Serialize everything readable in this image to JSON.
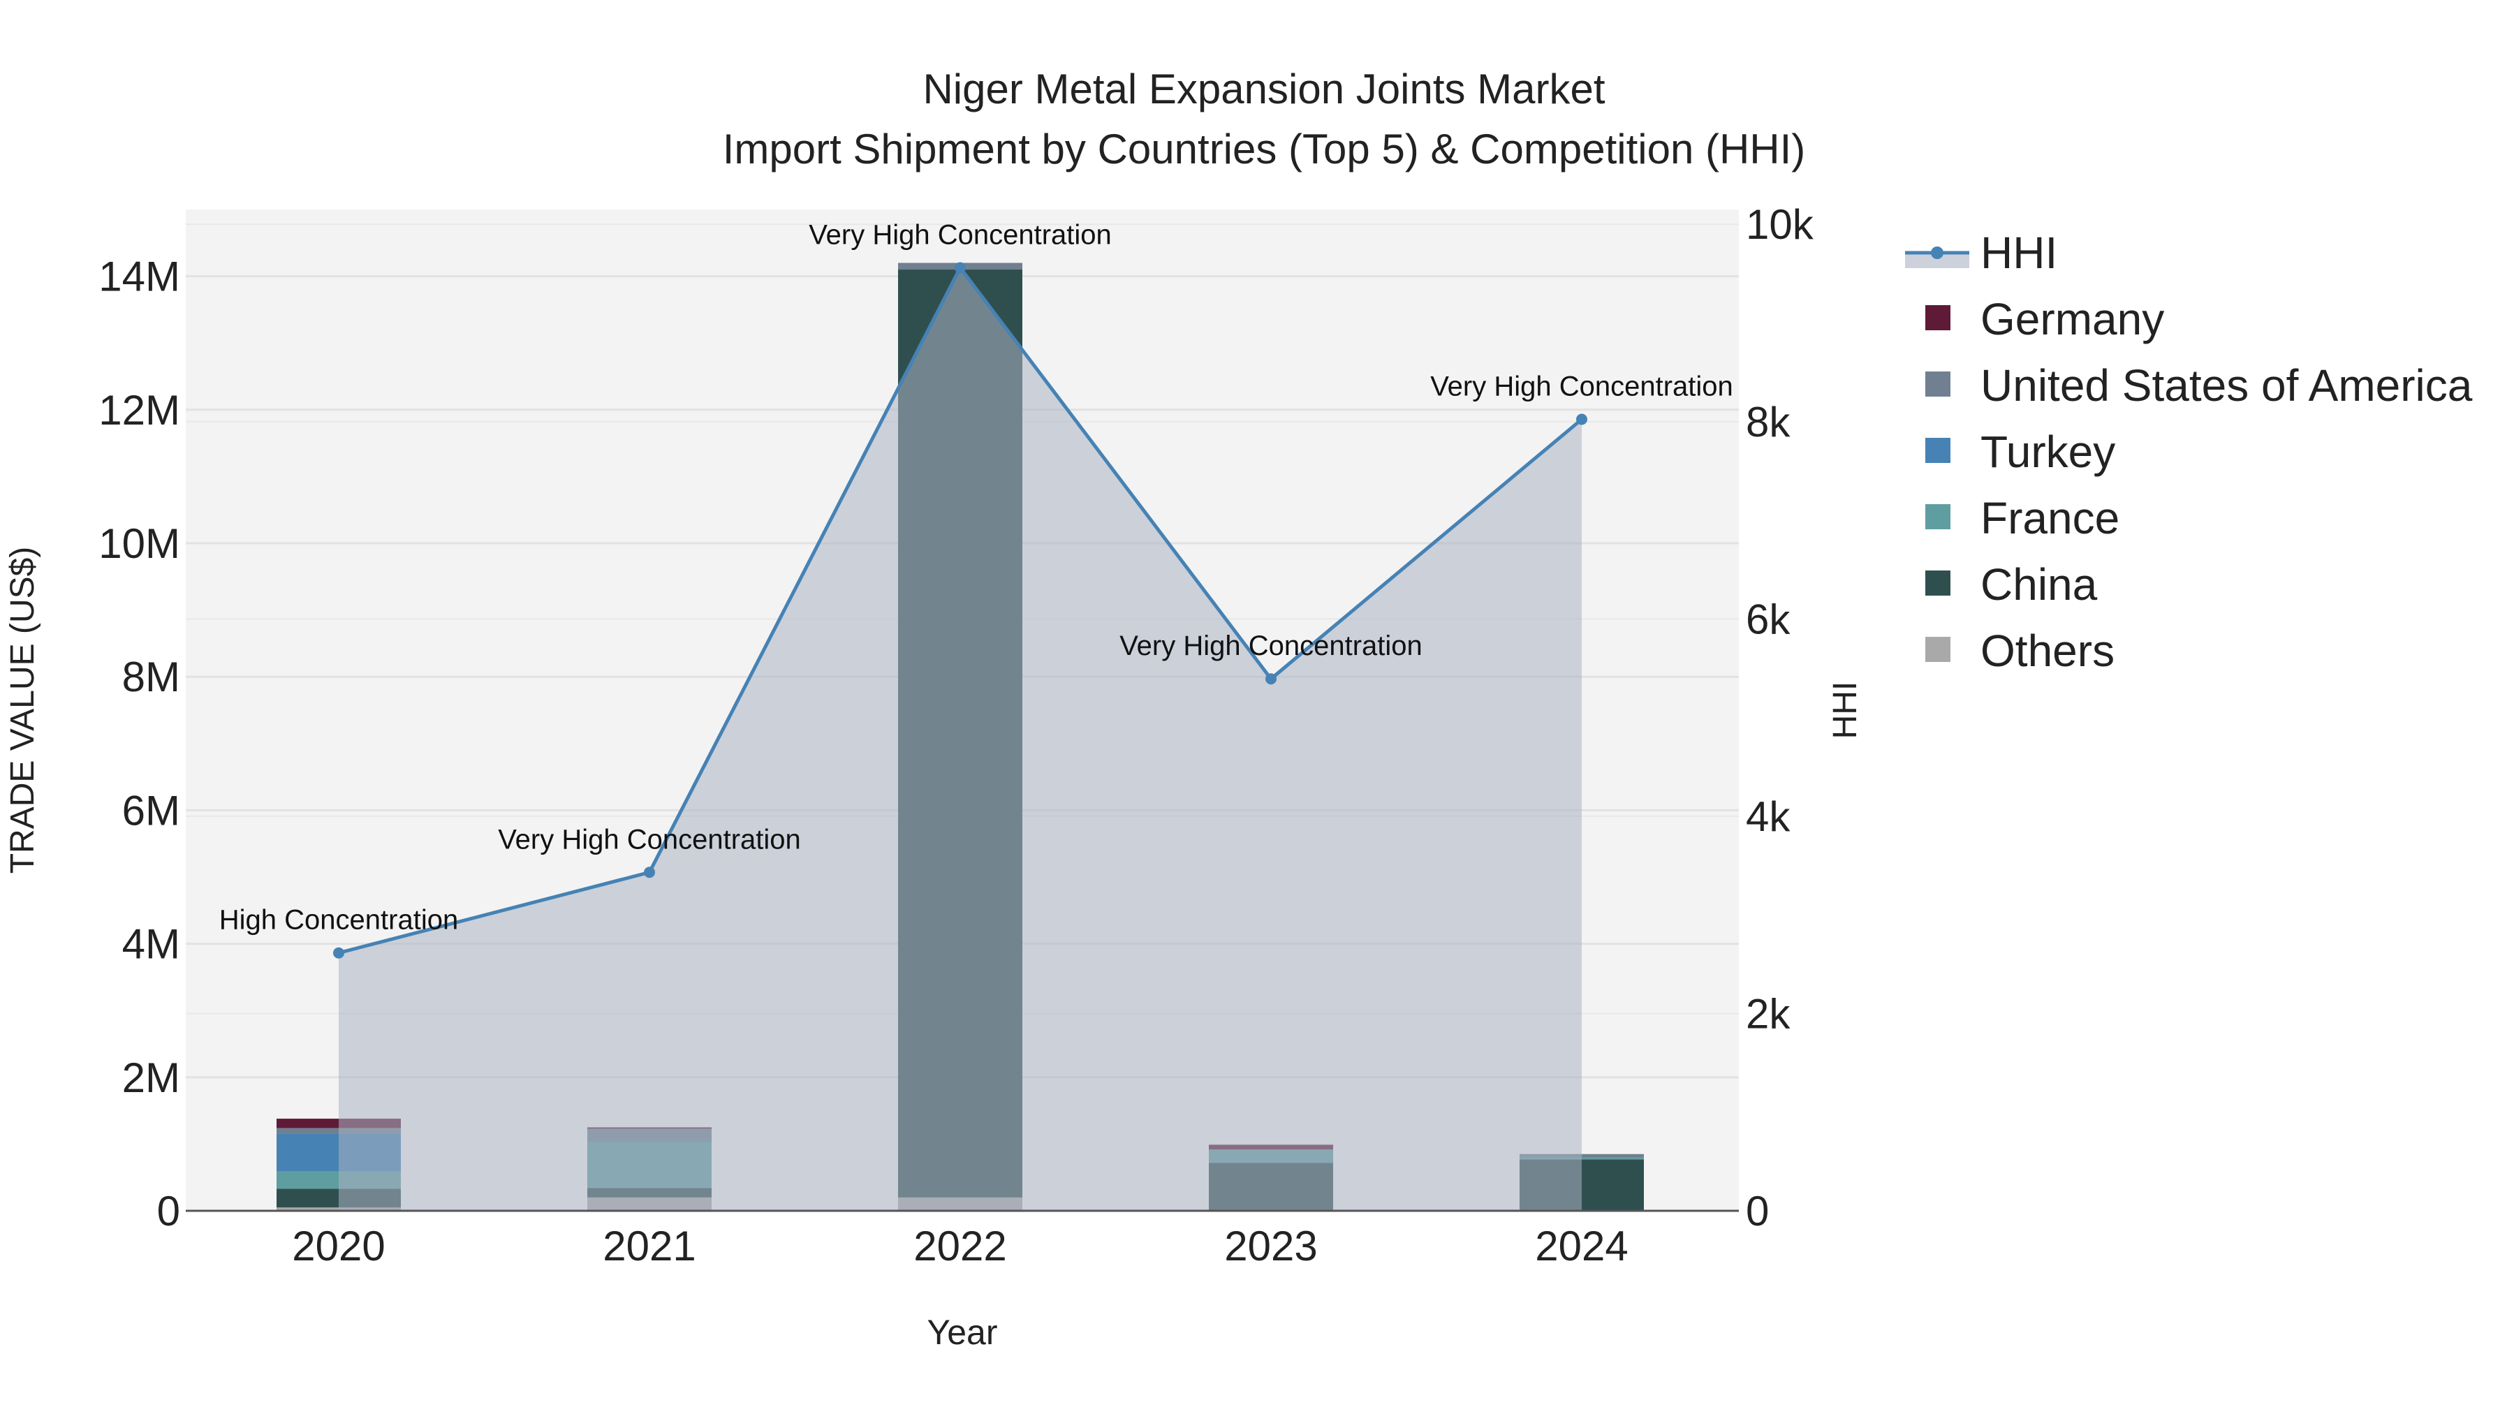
{
  "chart_data": {
    "type": "bar",
    "title_line1": "Niger Metal Expansion Joints Market",
    "title_line2": "Import Shipment by Countries (Top 5) & Competition (HHI)",
    "xlabel": "Year",
    "ylabel": "TRADE VALUE (US$)",
    "y2label": "HHI",
    "categories": [
      "2020",
      "2021",
      "2022",
      "2023",
      "2024"
    ],
    "ylim": [
      0,
      15000000
    ],
    "y2lim": [
      0,
      10150
    ],
    "yticks": [
      {
        "v": 0,
        "label": "0"
      },
      {
        "v": 2000000,
        "label": "2M"
      },
      {
        "v": 4000000,
        "label": "4M"
      },
      {
        "v": 6000000,
        "label": "6M"
      },
      {
        "v": 8000000,
        "label": "8M"
      },
      {
        "v": 10000000,
        "label": "10M"
      },
      {
        "v": 12000000,
        "label": "12M"
      },
      {
        "v": 14000000,
        "label": "14M"
      }
    ],
    "y2ticks": [
      {
        "v": 0,
        "label": "0"
      },
      {
        "v": 2000,
        "label": "2k"
      },
      {
        "v": 4000,
        "label": "4k"
      },
      {
        "v": 6000,
        "label": "6k"
      },
      {
        "v": 8000,
        "label": "8k"
      },
      {
        "v": 10000,
        "label": "10k"
      }
    ],
    "series": [
      {
        "name": "Others",
        "color": "#a9a9a9",
        "values": [
          50000,
          200000,
          200000,
          10000,
          10000
        ]
      },
      {
        "name": "China",
        "color": "#2f4f4f",
        "values": [
          280000,
          140000,
          13900000,
          710000,
          760000
        ]
      },
      {
        "name": "France",
        "color": "#5f9ea0",
        "values": [
          260000,
          690000,
          0,
          190000,
          30000
        ]
      },
      {
        "name": "Turkey",
        "color": "#4682b4",
        "values": [
          570000,
          10000,
          0,
          0,
          0
        ]
      },
      {
        "name": "United States of America",
        "color": "#708090",
        "values": [
          80000,
          190000,
          100000,
          10000,
          50000
        ]
      },
      {
        "name": "Germany",
        "color": "#5f1a37",
        "values": [
          140000,
          20000,
          0,
          70000,
          0
        ]
      }
    ],
    "hhi": {
      "name": "HHI",
      "color": "#4682b4",
      "values": [
        2614,
        3431,
        9559,
        5392,
        8023
      ],
      "annotations": [
        "High Concentration",
        "Very High Concentration",
        "Very High Concentration",
        "Very High Concentration",
        "Very High Concentration"
      ]
    },
    "legend_order": [
      "HHI",
      "Germany",
      "United States of America",
      "Turkey",
      "France",
      "China",
      "Others"
    ],
    "legend_position": "right"
  }
}
